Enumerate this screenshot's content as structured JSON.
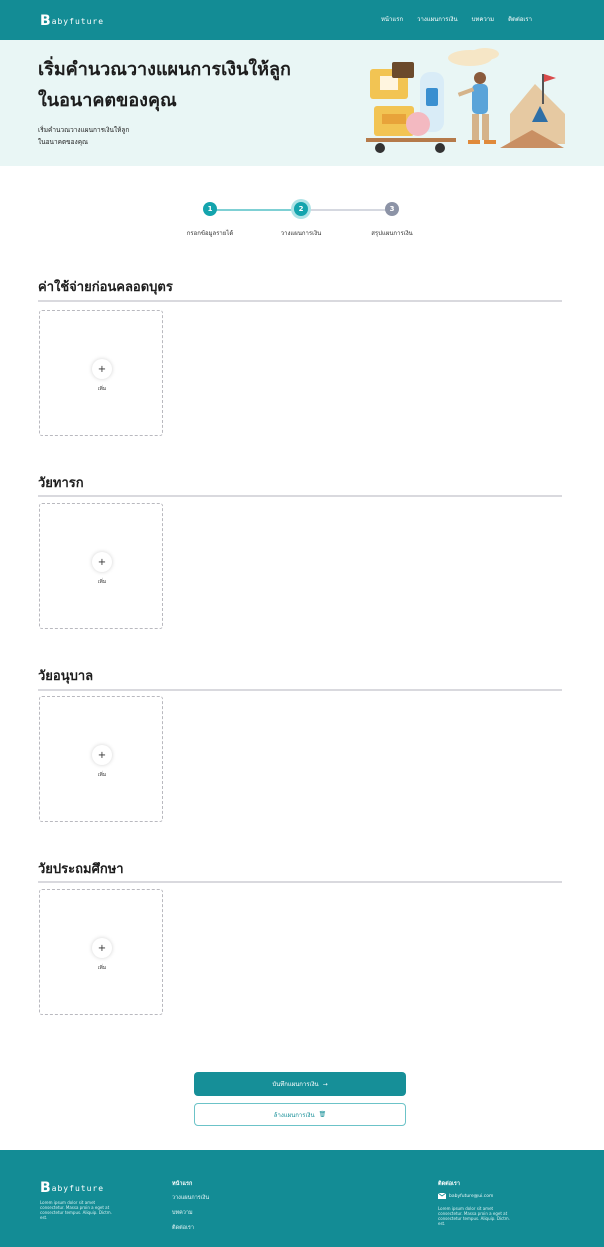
{
  "brand": {
    "mark": "B",
    "word": "abyfuture"
  },
  "nav": [
    "หน้าแรก",
    "วางแผนการเงิน",
    "บทความ",
    "ติดต่อเรา"
  ],
  "hero": {
    "title_line1": "เริ่มคำนวณวางแผนการเงินให้ลูก",
    "title_line2": "ในอนาคตของคุณ",
    "sub_line1": "เริ่มคำนวณวางแผนการเงินให้ลูก",
    "sub_line2": "ในอนาคตของคุณ"
  },
  "stepper": {
    "steps": [
      {
        "num": "1",
        "label": "กรอกข้อมูลรายได้",
        "state": "done"
      },
      {
        "num": "2",
        "label": "วางแผนการเงิน",
        "state": "active"
      },
      {
        "num": "3",
        "label": "สรุปแผนการเงิน",
        "state": "pending"
      }
    ]
  },
  "sections": [
    {
      "title": "ค่าใช้จ่ายก่อนคลอดบุตร",
      "add_label": "เพิ่ม"
    },
    {
      "title": "วัยทารก",
      "add_label": "เพิ่ม"
    },
    {
      "title": "วัยอนุบาล",
      "add_label": "เพิ่ม"
    },
    {
      "title": "วัยประถมศึกษา",
      "add_label": "เพิ่ม"
    }
  ],
  "actions": {
    "primary_label": "บันทึกแผนการเงิน",
    "primary_icon": "→",
    "secondary_label": "ล้างแผนการเงิน",
    "secondary_icon": "🗑"
  },
  "footer": {
    "desc": "Lorem ipsum dolor sit amet consectetur. Massa proin a eget at consectetur tempus. Aliquip. Dictm. est.",
    "menu_head": "หน้าแรก",
    "links": [
      "วางแผนการเงิน",
      "บทความ",
      "ติดต่อเรา"
    ],
    "contact_head": "ติดต่อเรา",
    "email": "babyfuture@ui.com",
    "contact_desc": "Lorem ipsum dolor sit amet consectetur. Massa proin a eget at consectetur tempus. Aliquip. Dictm. est."
  },
  "colors": {
    "primary": "#138c95",
    "hero_bg": "#e9f6f5",
    "pending": "#8c93a6"
  }
}
